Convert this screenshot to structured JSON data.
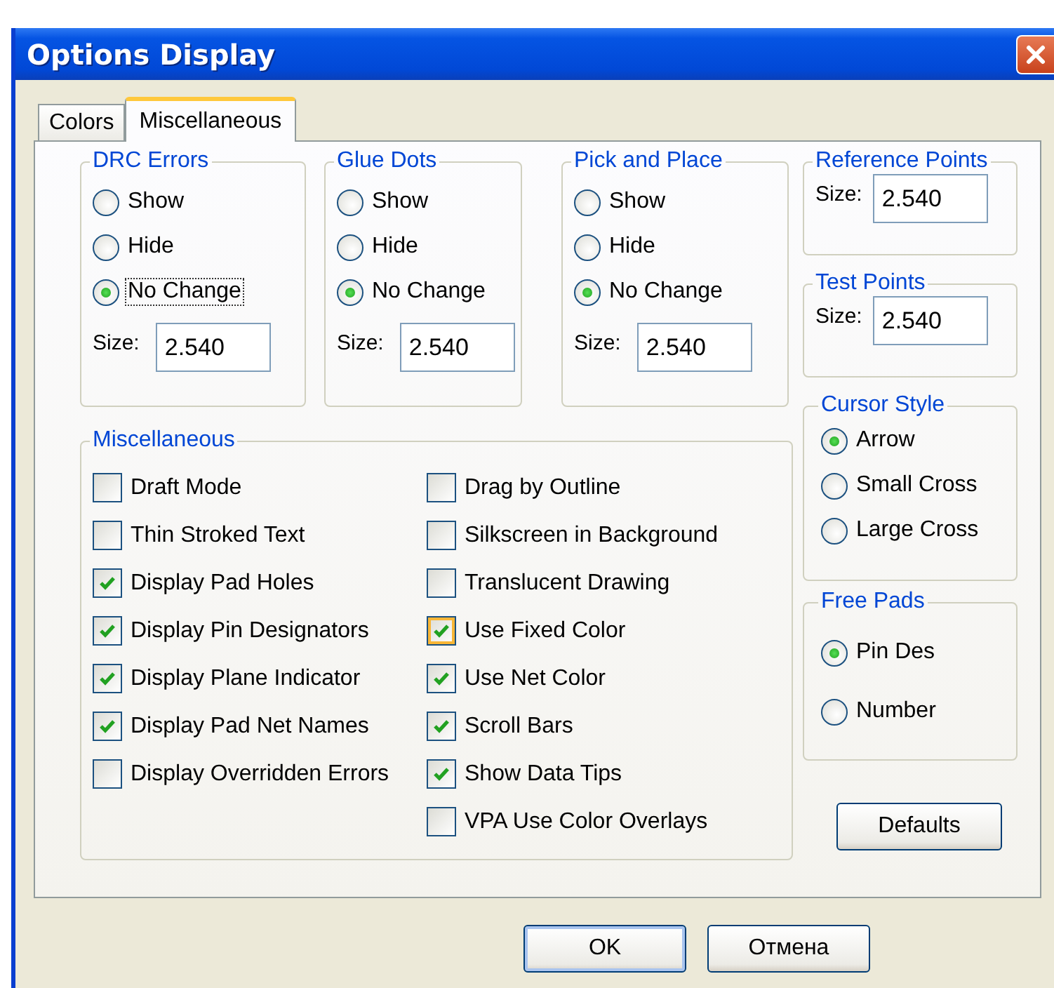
{
  "window": {
    "title": "Options Display"
  },
  "tabs": [
    {
      "label": "Colors",
      "selected": false
    },
    {
      "label": "Miscellaneous",
      "selected": true
    }
  ],
  "display_groups": [
    {
      "title": "DRC Errors",
      "options": [
        {
          "label": "Show",
          "selected": false,
          "focused": false
        },
        {
          "label": "Hide",
          "selected": false,
          "focused": false
        },
        {
          "label": "No Change",
          "selected": true,
          "focused": true
        }
      ],
      "size_label": "Size:",
      "size": "2.540"
    },
    {
      "title": "Glue Dots",
      "options": [
        {
          "label": "Show",
          "selected": false,
          "focused": false
        },
        {
          "label": "Hide",
          "selected": false,
          "focused": false
        },
        {
          "label": "No Change",
          "selected": true,
          "focused": false
        }
      ],
      "size_label": "Size:",
      "size": "2.540"
    },
    {
      "title": "Pick and Place",
      "options": [
        {
          "label": "Show",
          "selected": false,
          "focused": false
        },
        {
          "label": "Hide",
          "selected": false,
          "focused": false
        },
        {
          "label": "No Change",
          "selected": true,
          "focused": false
        }
      ],
      "size_label": "Size:",
      "size": "2.540"
    }
  ],
  "misc": {
    "title": "Miscellaneous",
    "columns": [
      [
        {
          "label": "Draft Mode",
          "checked": false,
          "hovered": false
        },
        {
          "label": "Thin Stroked Text",
          "checked": false,
          "hovered": false
        },
        {
          "label": "Display Pad Holes",
          "checked": true,
          "hovered": false
        },
        {
          "label": "Display Pin Designators",
          "checked": true,
          "hovered": false
        },
        {
          "label": "Display Plane Indicator",
          "checked": true,
          "hovered": false
        },
        {
          "label": "Display Pad Net Names",
          "checked": true,
          "hovered": false
        },
        {
          "label": "Display Overridden Errors",
          "checked": false,
          "hovered": false
        }
      ],
      [
        {
          "label": "Drag by Outline",
          "checked": false,
          "hovered": false
        },
        {
          "label": "Silkscreen in Background",
          "checked": false,
          "hovered": false
        },
        {
          "label": "Translucent Drawing",
          "checked": false,
          "hovered": false
        },
        {
          "label": "Use Fixed Color",
          "checked": true,
          "hovered": true
        },
        {
          "label": "Use Net Color",
          "checked": true,
          "hovered": false
        },
        {
          "label": "Scroll Bars",
          "checked": true,
          "hovered": false
        },
        {
          "label": "Show Data Tips",
          "checked": true,
          "hovered": false
        },
        {
          "label": "VPA Use Color Overlays",
          "checked": false,
          "hovered": false
        }
      ]
    ]
  },
  "point_groups": [
    {
      "title": "Reference Points",
      "size_label": "Size:",
      "size": "2.540"
    },
    {
      "title": "Test Points",
      "size_label": "Size:",
      "size": "2.540"
    }
  ],
  "cursor_style": {
    "title": "Cursor Style",
    "options": [
      {
        "label": "Arrow",
        "selected": true
      },
      {
        "label": "Small Cross",
        "selected": false
      },
      {
        "label": "Large Cross",
        "selected": false
      }
    ]
  },
  "free_pads": {
    "title": "Free Pads",
    "options": [
      {
        "label": "Pin Des",
        "selected": true
      },
      {
        "label": "Number",
        "selected": false
      }
    ]
  },
  "defaults_button": "Defaults",
  "buttons": [
    {
      "label": "OK",
      "default": true
    },
    {
      "label": "Отмена",
      "default": false
    }
  ]
}
